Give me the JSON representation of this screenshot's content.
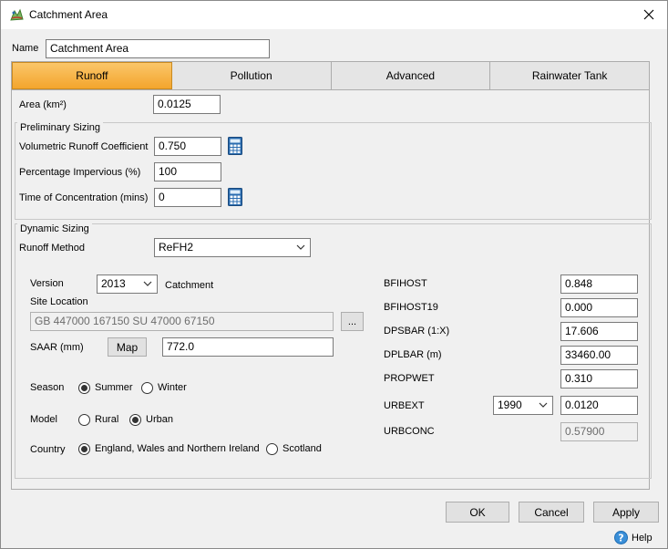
{
  "window": {
    "title": "Catchment Area",
    "close_glyph": "✕"
  },
  "name_field": {
    "label": "Name",
    "value": "Catchment Area"
  },
  "tabs": [
    {
      "label": "Runoff",
      "active": true
    },
    {
      "label": "Pollution",
      "active": false
    },
    {
      "label": "Advanced",
      "active": false
    },
    {
      "label": "Rainwater Tank",
      "active": false
    }
  ],
  "area": {
    "label": "Area (km²)",
    "value": "0.0125"
  },
  "preliminary": {
    "title": "Preliminary Sizing",
    "vrc": {
      "label": "Volumetric Runoff Coefficient",
      "value": "0.750"
    },
    "pimp": {
      "label": "Percentage Impervious (%)",
      "value": "100"
    },
    "toc": {
      "label": "Time of Concentration (mins)",
      "value": "0"
    }
  },
  "dynamic": {
    "title": "Dynamic Sizing",
    "runoff_method": {
      "label": "Runoff Method",
      "value": "ReFH2"
    },
    "version": {
      "label": "Version",
      "value": "2013",
      "suffix": "Catchment"
    },
    "site_location": {
      "label": "Site Location",
      "value": "GB 447000 167150 SU 47000 67150",
      "browse_label": "..."
    },
    "saar": {
      "label": "SAAR (mm)",
      "map_label": "Map",
      "value": "772.0"
    },
    "season": {
      "label": "Season",
      "options": [
        "Summer",
        "Winter"
      ],
      "selected": "Summer"
    },
    "model": {
      "label": "Model",
      "options": [
        "Rural",
        "Urban"
      ],
      "selected": "Urban"
    },
    "country": {
      "label": "Country",
      "options": [
        "England, Wales and Northern Ireland",
        "Scotland"
      ],
      "selected": "England, Wales and Northern Ireland"
    },
    "params": {
      "bfihost": {
        "label": "BFIHOST",
        "value": "0.848"
      },
      "bfihost19": {
        "label": "BFIHOST19",
        "value": "0.000"
      },
      "dpsbar": {
        "label": "DPSBAR (1:X)",
        "value": "17.606"
      },
      "dplbar": {
        "label": "DPLBAR (m)",
        "value": "33460.00"
      },
      "propwet": {
        "label": "PROPWET",
        "value": "0.310"
      },
      "urbext": {
        "label": "URBEXT",
        "year": "1990",
        "value": "0.0120"
      },
      "urbconc": {
        "label": "URBCONC",
        "value": "0.57900"
      }
    }
  },
  "footer": {
    "ok_label": "OK",
    "cancel_label": "Cancel",
    "apply_label": "Apply",
    "help_label": "Help"
  },
  "colors": {
    "tab_active": "#f3a52c",
    "calculator": "#2a6cb0",
    "help": "#3a8fd8"
  },
  "icons": {
    "app": "catchment-icon",
    "calc": "calculator-icon",
    "help": "help-icon",
    "close": "close-icon"
  }
}
